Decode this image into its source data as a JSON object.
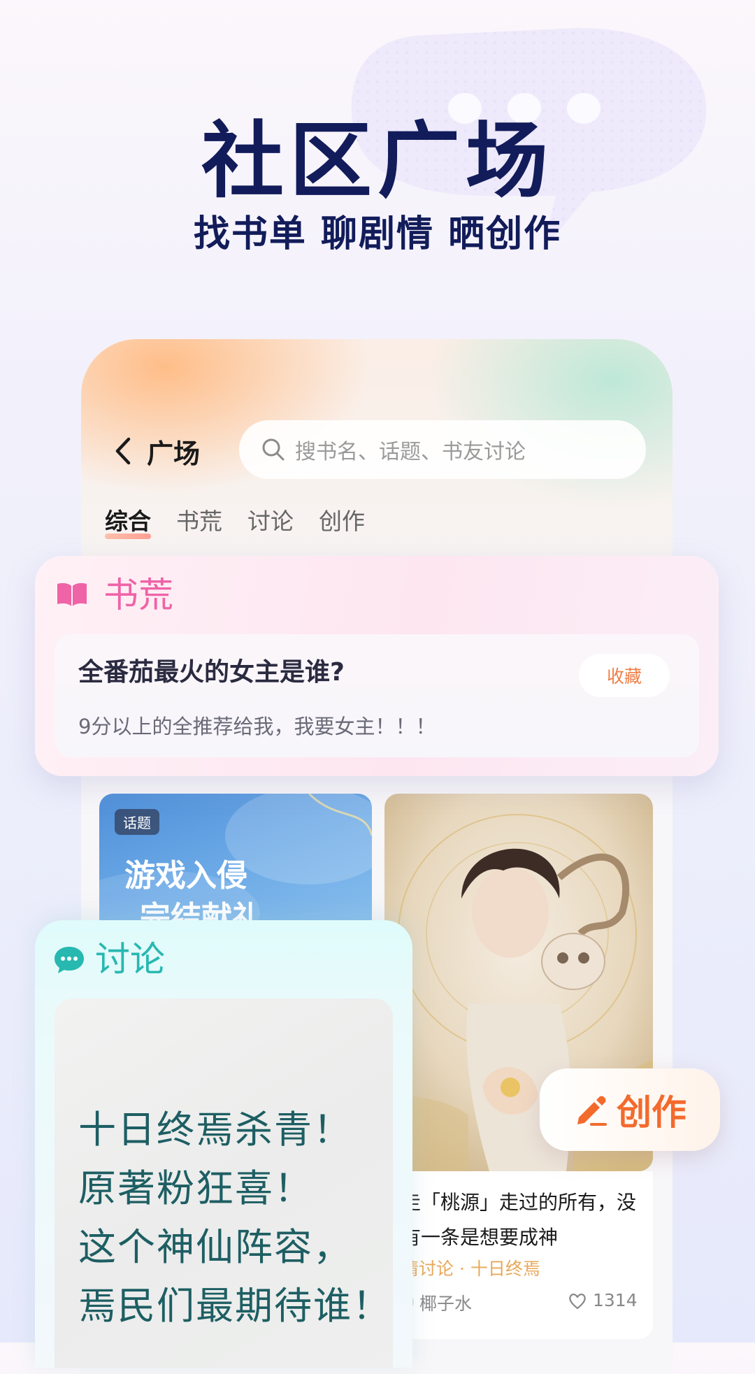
{
  "hero": {
    "title": "社区广场",
    "subtitle": "找书单 聊剧情 晒创作"
  },
  "header": {
    "back_label": "广场",
    "search_placeholder": "搜书名、话题、书友讨论"
  },
  "tabs": [
    {
      "label": "综合",
      "active": true
    },
    {
      "label": "书荒",
      "active": false
    },
    {
      "label": "讨论",
      "active": false
    },
    {
      "label": "创作",
      "active": false
    }
  ],
  "shuhuang_card": {
    "label": "书荒",
    "icon": "book-icon",
    "question": "全番茄最火的女主是谁?",
    "description": "9分以上的全推荐给我，我要女主！！！",
    "collect_label": "收藏"
  },
  "topic_card": {
    "badge": "话题",
    "title_line1": "游戏入侵",
    "title_line2": "完结献礼"
  },
  "post_card": {
    "title": "走「桃源」走过的所有，没有一条是想要成神",
    "tag": "情讨论 · 十日终焉",
    "author": "椰子水",
    "likes": "1314"
  },
  "taolun_card": {
    "label": "讨论",
    "icon": "chat-icon",
    "lines": [
      "十日终焉杀青！",
      "原著粉狂喜！",
      "这个神仙阵容，",
      "焉民们最期待谁！"
    ]
  },
  "chuangzuo_button": {
    "label": "创作",
    "icon": "pen-icon"
  },
  "colors": {
    "title_navy": "#121c5a",
    "pink": "#ef63a7",
    "teal": "#27b8b0",
    "orange": "#f36a2c"
  }
}
